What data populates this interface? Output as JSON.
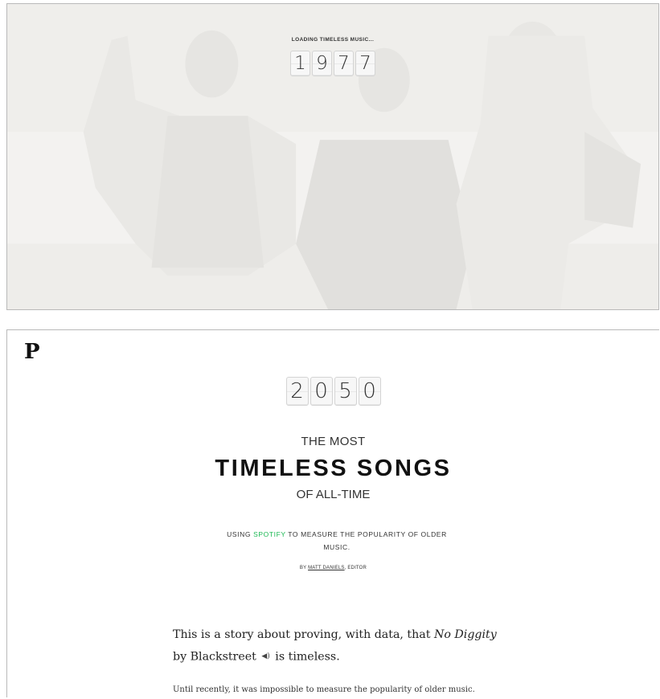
{
  "loading_screen": {
    "status_text": "LOADING TIMELESS MUSIC...",
    "year_digits": [
      "1",
      "9",
      "7",
      "7"
    ]
  },
  "article": {
    "logo_letter": "P",
    "year_digits": [
      "2",
      "0",
      "5",
      "0"
    ],
    "kicker": "THE MOST",
    "headline": "TIMELESS SONGS",
    "subkicker": "OF ALL-TIME",
    "dek_prefix": "USING ",
    "dek_brand": "SPOTIFY",
    "dek_suffix": " TO MEASURE THE POPULARITY OF OLDER MUSIC.",
    "byline_prefix": "BY ",
    "byline_author": "MATT DANIELS",
    "byline_suffix": ", EDITOR",
    "lede_part1": "This is a story about proving, with data, that ",
    "lede_song": "No Diggity",
    "lede_part2": " by Blackstreet ",
    "lede_speaker_icon": "speaker-icon",
    "lede_part3": " is timeless.",
    "paragraph2": "Until recently, it was impossible to measure the popularity of older music."
  },
  "colors": {
    "spotify_green": "#1db954",
    "loading_background": "#f4f3f1",
    "digit_tile": "#f7f7f7"
  }
}
